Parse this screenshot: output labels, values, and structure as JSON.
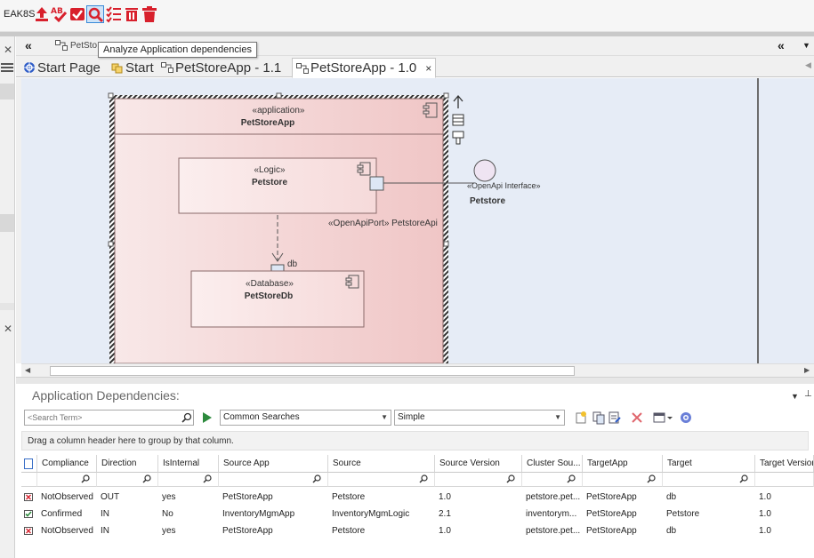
{
  "ribbon": {
    "label": "EAK8S",
    "tooltip": "Analyze Application dependencies"
  },
  "header": {
    "breadcrumb": "PetSto"
  },
  "tabs": [
    {
      "label": "Start Page"
    },
    {
      "label": "Start"
    },
    {
      "label": "PetStoreApp - 1.1"
    },
    {
      "label": "PetStoreApp - 1.0"
    }
  ],
  "tab_close": "×",
  "diagram": {
    "outer": {
      "stereotype": "«application»",
      "name": "PetStoreApp"
    },
    "logic": {
      "stereotype": "«Logic»",
      "name": "Petstore"
    },
    "database": {
      "stereotype": "«Database»",
      "name": "PetStoreDb"
    },
    "port_label": "«OpenApiPort» PetstoreApi",
    "db_port_label": "db",
    "interface": {
      "stereotype": "«OpenApi Interface»",
      "name": "Petstore"
    }
  },
  "panel": {
    "title": "Application Dependencies:",
    "search_placeholder": "<Search Term>",
    "searches_value": "Common Searches",
    "mode_value": "Simple",
    "group_hint": "Drag a column header here to group by that column.",
    "columns": [
      "Compliance",
      "Direction",
      "IsInternal",
      "Source App",
      "Source",
      "Source Version",
      "Cluster Sou...",
      "TargetApp",
      "Target",
      "Target Version"
    ],
    "rows": [
      {
        "status": "error",
        "cells": [
          "NotObserved",
          "OUT",
          "yes",
          "PetStoreApp",
          "Petstore",
          "1.0",
          "petstore.pet...",
          "PetStoreApp",
          "db",
          "1.0"
        ]
      },
      {
        "status": "ok",
        "cells": [
          "Confirmed",
          "IN",
          "No",
          "InventoryMgmApp",
          "InventoryMgmLogic",
          "2.1",
          "inventorym...",
          "PetStoreApp",
          "Petstore",
          "1.0"
        ]
      },
      {
        "status": "error",
        "cells": [
          "NotObserved",
          "IN",
          "yes",
          "PetStoreApp",
          "Petstore",
          "1.0",
          "petstore.pet...",
          "PetStoreApp",
          "db",
          "1.0"
        ]
      }
    ]
  },
  "colors": {
    "accent_red": "#d8202c",
    "selected_blue": "#3a8ad8",
    "component_fill": "#f1c9c9",
    "canvas_bg": "#e6ecf6"
  },
  "icons": {
    "ribbon": [
      "upload-icon",
      "spellcheck-icon",
      "validate-icon",
      "analyze-icon",
      "checklist-icon",
      "delete-icon",
      "trash-icon"
    ]
  }
}
